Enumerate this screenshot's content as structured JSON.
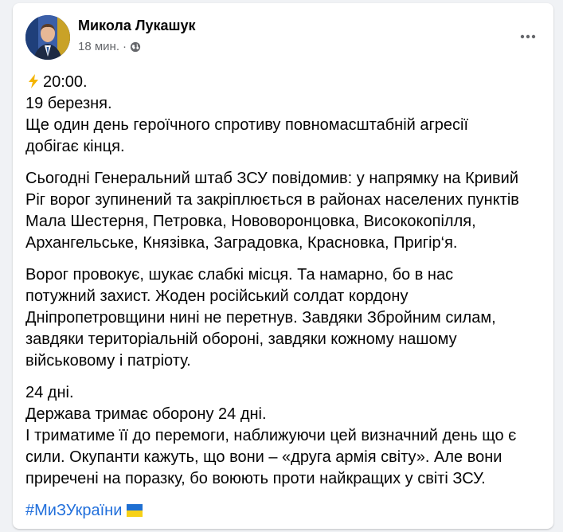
{
  "post": {
    "author": "Микола Лукашук",
    "timestamp": "18 мин.",
    "separator": "·",
    "privacy_icon": "globe-icon",
    "more_icon": "more-options-icon",
    "paragraphs": [
      [
        "20:00.",
        "19 березня.",
        "Ще один день героїчного спротиву повномасштабній агресії",
        "добігає кінця."
      ],
      [
        "Сьогодні Генеральний штаб ЗСУ повідомив: у напрямку на Кривий",
        "Ріг ворог зупинений та закріплюється в районах населених пунктів",
        "Мала Шестерня, Петровка, Нововоронцовка, Висококопілля,",
        "Архангельське, Князівка, Заградовка, Красновка, Пригір‘я."
      ],
      [
        "Ворог провокує, шукає слабкі місця. Та намарно, бо в нас",
        "потужний захист. Жоден російський солдат кордону",
        "Дніпропетровщини нині не перетнув. Завдяки Збройним силам,",
        "завдяки територіальній обороні, завдяки кожному нашому",
        "військовому і патріоту."
      ],
      [
        "24 дні.",
        "Держава тримає оборону 24 дні.",
        "І триматиме її до перемоги, наближуючи цей визначний день що є",
        "сили. Окупанти кажуть, що вони – «друга армія світу». Але вони",
        "приречені на поразку, бо воюють проти найкращих у світі ЗСУ."
      ]
    ],
    "hashtag": "#МиЗУкраїни",
    "colors": {
      "hashtag": "#216fdb",
      "text": "#050505",
      "meta": "#65676b",
      "background": "#f0f2f5"
    }
  }
}
